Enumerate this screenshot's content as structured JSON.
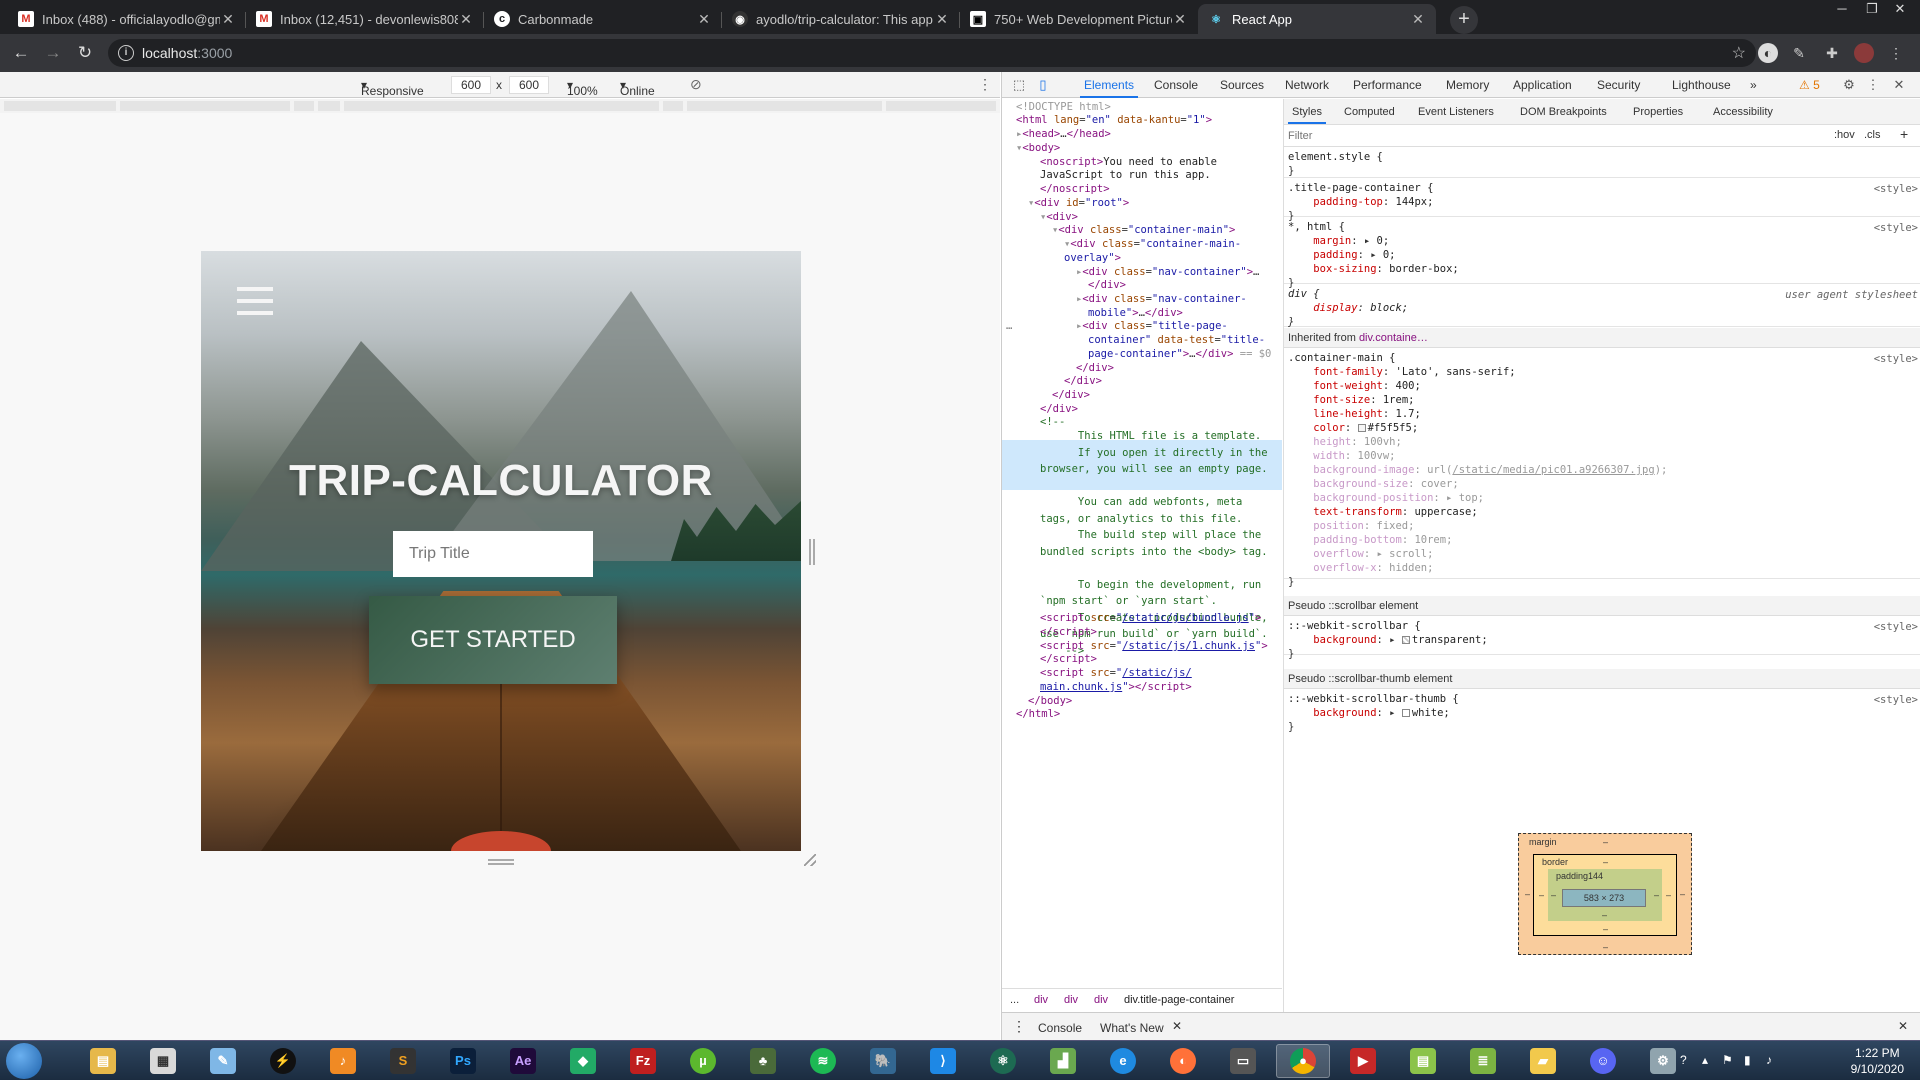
{
  "browser": {
    "tabs": [
      {
        "title": "Inbox (488) - officialayodlo@gm",
        "favicon": "gmail-icon",
        "active": false
      },
      {
        "title": "Inbox (12,451) - devonlewis808@",
        "favicon": "gmail-icon",
        "active": false
      },
      {
        "title": "Carbonmade",
        "favicon": "carbonmade-icon",
        "active": false
      },
      {
        "title": "ayodlo/trip-calculator: This app i",
        "favicon": "github-icon",
        "active": false
      },
      {
        "title": "750+ Web Development Picture",
        "favicon": "unsplash-icon",
        "active": false
      },
      {
        "title": "React App",
        "favicon": "react-icon",
        "active": true
      }
    ],
    "url_host": "localhost",
    "url_port": ":3000"
  },
  "device_toolbar": {
    "mode": "Responsive",
    "width": "600",
    "height": "600",
    "times": "x",
    "zoom": "100%",
    "network": "Online"
  },
  "app": {
    "title": "TRIP-CALCULATOR",
    "input_placeholder": "Trip Title",
    "cta_label": "GET STARTED"
  },
  "devtools": {
    "tabs": [
      "Elements",
      "Console",
      "Sources",
      "Network",
      "Performance",
      "Memory",
      "Application",
      "Security",
      "Lighthouse"
    ],
    "more": "»",
    "warnings": "5",
    "style_tabs": [
      "Styles",
      "Computed",
      "Event Listeners",
      "DOM Breakpoints",
      "Properties",
      "Accessibility"
    ],
    "filter_placeholder": "Filter",
    "hov": ":hov",
    "cls": ".cls",
    "breadcrumbs": [
      "...",
      "div",
      "div",
      "div",
      "div.title-page-container"
    ],
    "drawer_tabs": [
      "Console",
      "What's New"
    ],
    "inherited_label": "Inherited from",
    "inherited_from": "div.containe…",
    "pseudo_scrollbar": "Pseudo ::scrollbar element",
    "pseudo_thumb": "Pseudo ::scrollbar-thumb element",
    "style_source": "<style>",
    "ua_source": "user agent stylesheet",
    "box_model": {
      "margin": "margin",
      "border": "border",
      "padding": "padding144",
      "content": "583 × 273",
      "dash": "–"
    }
  },
  "clock": {
    "time": "1:22 PM",
    "date": "9/10/2020"
  },
  "colors": {
    "accent": "#1a73e8",
    "cta_green": "#355a45",
    "tab_bar": "#202124"
  }
}
